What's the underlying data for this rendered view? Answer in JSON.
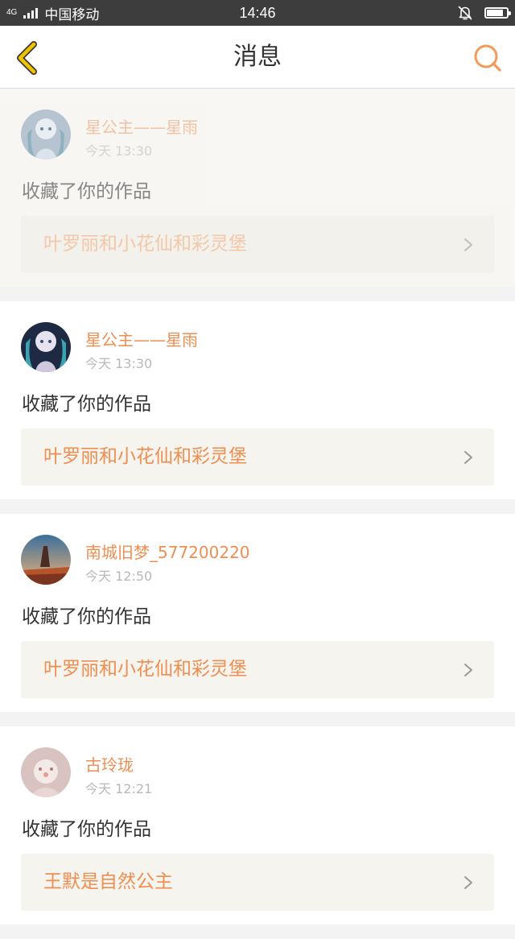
{
  "status_bar": {
    "network": "4G",
    "carrier": "中国移动",
    "time": "14:46",
    "icons": [
      "signal-icon",
      "mute-bell-icon",
      "battery-icon"
    ],
    "battery_level": 0.85
  },
  "header": {
    "title": "消息",
    "back_icon": "chevron-left-icon",
    "search_icon": "search-icon",
    "colors": {
      "back": "#f2c200",
      "search": "#f39a5a"
    }
  },
  "messages": [
    {
      "username": "星公主——星雨",
      "time": "今天 13:30",
      "action": "收藏了你的作品",
      "work_title": "叶罗丽和小花仙和彩灵堡",
      "read": true
    },
    {
      "username": "星公主——星雨",
      "time": "今天 13:30",
      "action": "收藏了你的作品",
      "work_title": "叶罗丽和小花仙和彩灵堡",
      "read": false
    },
    {
      "username": "南城旧梦_577200220",
      "time": "今天 12:50",
      "action": "收藏了你的作品",
      "work_title": "叶罗丽和小花仙和彩灵堡",
      "read": false
    },
    {
      "username": "古玲珑",
      "time": "今天 12:21",
      "action": "收藏了你的作品",
      "work_title": "王默是自然公主",
      "read": false
    }
  ],
  "colors": {
    "accent": "#ef8e50",
    "link_background": "#f5f4ef"
  }
}
